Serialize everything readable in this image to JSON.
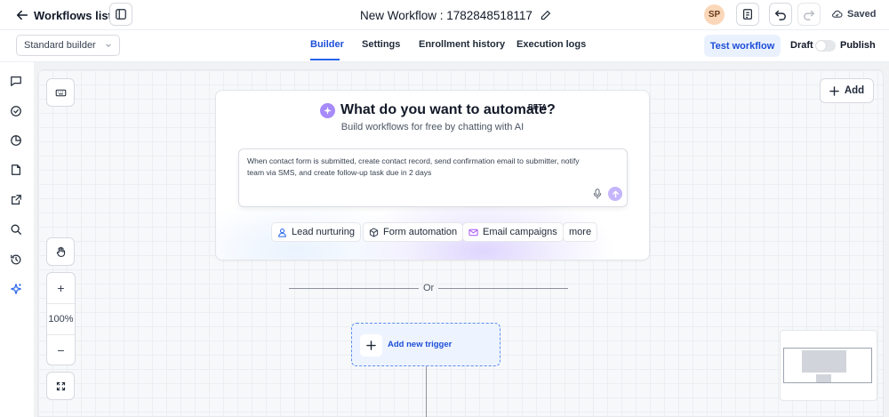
{
  "header": {
    "back_label": "Workflows list",
    "workflow_title": "New Workflow : 1782848518117",
    "avatar_initials": "SP",
    "status": "Saved"
  },
  "subbar": {
    "builder_mode": "Standard builder",
    "tabs": [
      {
        "label": "Builder",
        "active": true
      },
      {
        "label": "Settings",
        "active": false
      },
      {
        "label": "Enrollment history",
        "active": false
      },
      {
        "label": "Execution logs",
        "active": false
      }
    ],
    "test_label": "Test workflow",
    "draft_label": "Draft",
    "publish_label": "Publish"
  },
  "rail": {
    "icons": [
      "chat-icon",
      "check-circle-icon",
      "pie-chart-icon",
      "document-icon",
      "external-link-icon",
      "search-icon",
      "history-icon",
      "sparkle-icon"
    ]
  },
  "canvas": {
    "add_label": "Add",
    "zoom_level": "100%",
    "or_label": "Or",
    "trigger_label": "Add new trigger"
  },
  "ai": {
    "title": "What do you want to automate?",
    "badge": "BETA",
    "subtitle": "Build workflows for free by chatting with AI",
    "prompt_text": "When contact form is submitted, create contact record, send confirmation email to submitter, notify team via SMS, and create follow-up task due in 2 days",
    "chips": [
      {
        "label": "Lead nurturing",
        "icon": "user-icon"
      },
      {
        "label": "Form automation",
        "icon": "cube-icon"
      },
      {
        "label": "Email campaigns",
        "icon": "mail-icon"
      },
      {
        "label": "more",
        "icon": ""
      }
    ]
  },
  "colors": {
    "accent": "#2563eb",
    "ai_purple": "#a78bfa"
  }
}
